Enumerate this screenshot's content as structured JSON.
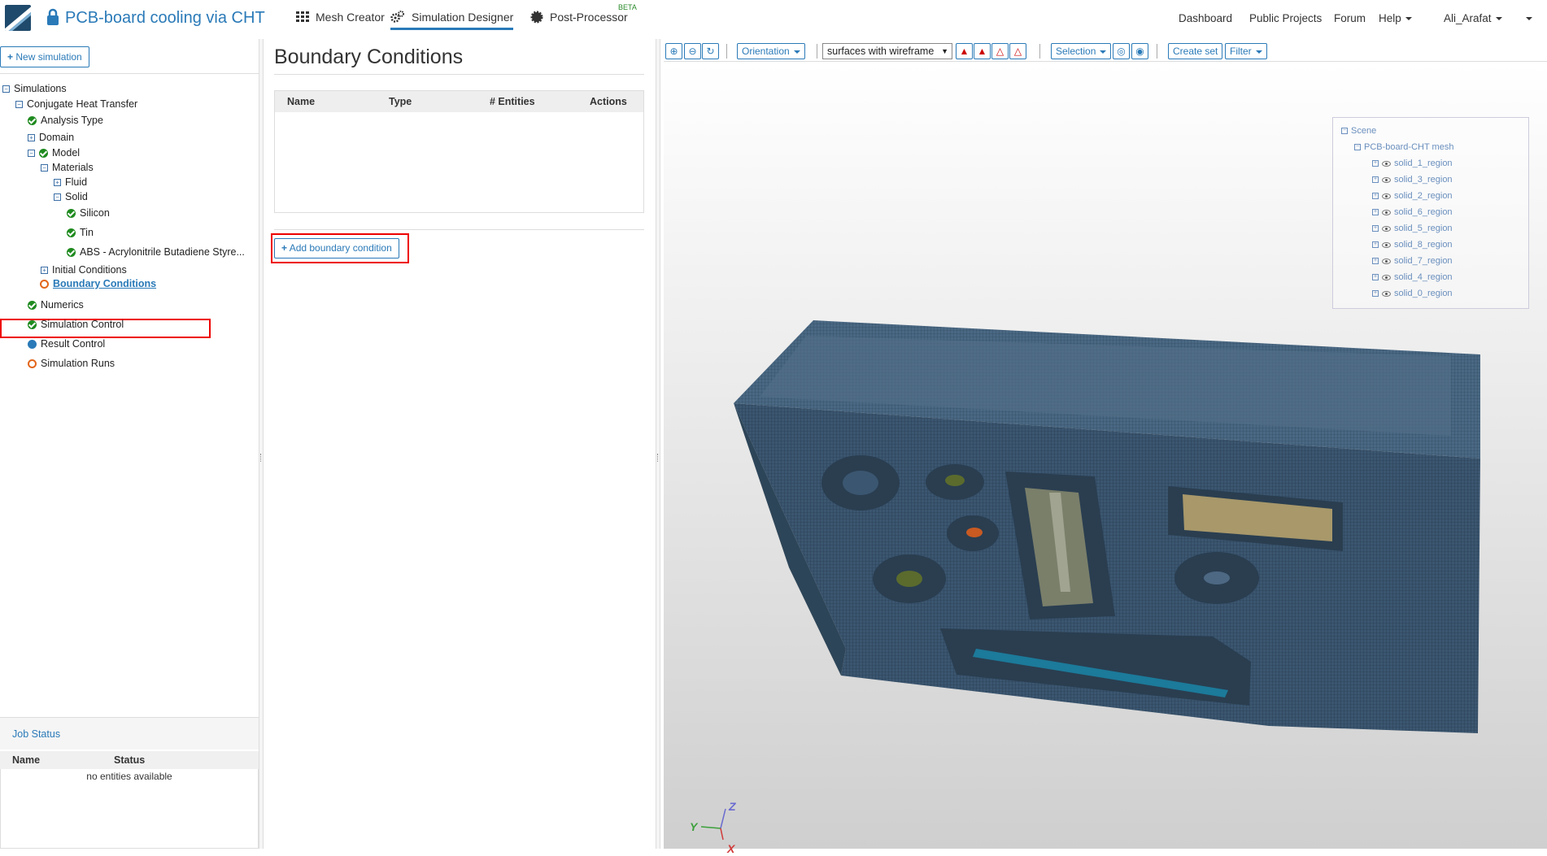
{
  "header": {
    "project_title": "PCB-board cooling via CHT",
    "tabs": [
      {
        "label": "Mesh Creator"
      },
      {
        "label": "Simulation Designer"
      },
      {
        "label": "Post-Processor"
      }
    ],
    "beta_badge": "BETA",
    "links": [
      "Dashboard",
      "Public Projects",
      "Forum",
      "Help"
    ],
    "user": "Ali_Arafat"
  },
  "left": {
    "new_simulation": "New simulation",
    "tree": {
      "simulations": "Simulations",
      "cht": "Conjugate Heat Transfer",
      "analysis_type": "Analysis Type",
      "domain": "Domain",
      "model": "Model",
      "materials": "Materials",
      "fluid": "Fluid",
      "solid": "Solid",
      "silicon": "Silicon",
      "tin": "Tin",
      "abs": "ABS - Acrylonitrile Butadiene Styre...",
      "initial_conditions": "Initial Conditions",
      "boundary_conditions": "Boundary Conditions",
      "numerics": "Numerics",
      "simulation_control": "Simulation Control",
      "result_control": "Result Control",
      "simulation_runs": "Simulation Runs"
    },
    "job_status": {
      "title": "Job Status",
      "col_name": "Name",
      "col_status": "Status",
      "empty": "no entities available"
    }
  },
  "middle": {
    "title": "Boundary Conditions",
    "table_headers": [
      "Name",
      "Type",
      "# Entities",
      "Actions"
    ],
    "add_button": "Add boundary condition"
  },
  "viewer": {
    "toolbar": {
      "orientation": "Orientation",
      "render_mode": "surfaces with wireframe",
      "selection": "Selection",
      "create_set": "Create set",
      "filter": "Filter"
    },
    "scene": {
      "root": "Scene",
      "mesh": "PCB-board-CHT mesh",
      "regions": [
        "solid_1_region",
        "solid_3_region",
        "solid_2_region",
        "solid_6_region",
        "solid_5_region",
        "solid_8_region",
        "solid_7_region",
        "solid_4_region",
        "solid_0_region"
      ]
    },
    "axes": {
      "x": "X",
      "y": "Y",
      "z": "Z"
    }
  },
  "colors": {
    "accent": "#2a7ab8",
    "ok": "#1e8a1e",
    "pending": "#e2661a",
    "mesh": "#3b5670"
  }
}
